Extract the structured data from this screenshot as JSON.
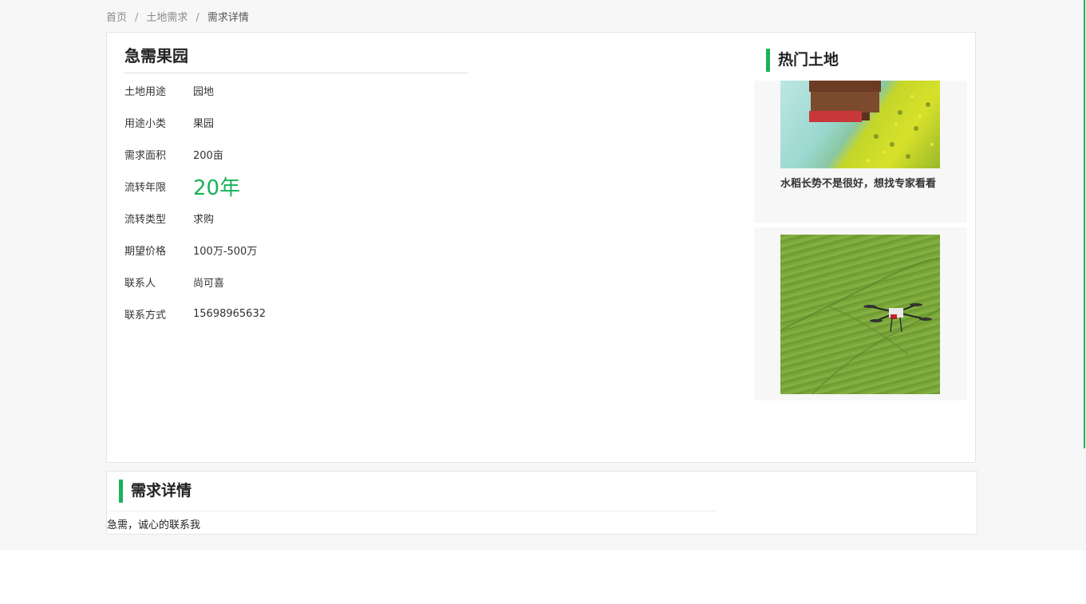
{
  "breadcrumb": {
    "home": "首页",
    "category": "土地需求",
    "current": "需求详情",
    "separator": "/"
  },
  "detail": {
    "title": "急需果园",
    "fields": [
      {
        "label": "土地用途",
        "value": "园地"
      },
      {
        "label": "用途小类",
        "value": "果园"
      },
      {
        "label": "需求面积",
        "value": "200亩"
      },
      {
        "label": "流转年限",
        "value": "20年"
      },
      {
        "label": "流转类型",
        "value": "求购"
      },
      {
        "label": "期望价格",
        "value": "100万-500万"
      },
      {
        "label": "联系人",
        "value": "尚可喜"
      },
      {
        "label": "联系方式",
        "value": "15698965632"
      }
    ]
  },
  "hot": {
    "title": "热门土地",
    "items": [
      {
        "caption": "水稻长势不是很好，想找专家看看",
        "image": "tractor-rapeseed-field"
      },
      {
        "caption": "",
        "image": "drone-over-wheat-field"
      }
    ]
  },
  "requirement": {
    "title": "需求详情",
    "body": "急需，诚心的联系我"
  },
  "colors": {
    "accent": "#19b35a",
    "background": "#f7f7f7"
  }
}
